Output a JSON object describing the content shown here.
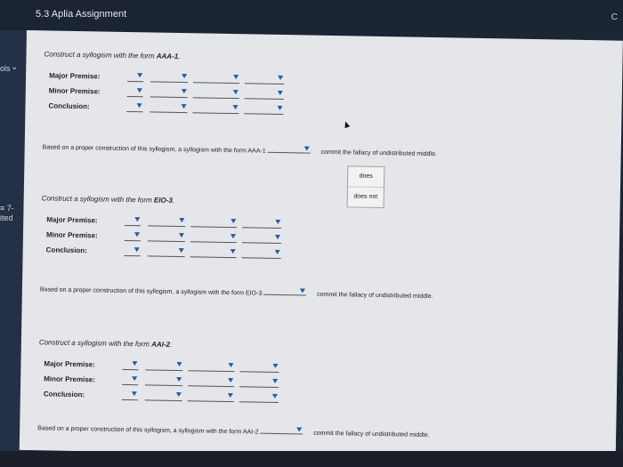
{
  "tab": {
    "title": "5.3 Aplia Assignment",
    "corner_char": "C"
  },
  "leftnav": {
    "item1": "ols",
    "item2": "≡ 7-",
    "item3": "ited"
  },
  "sections": [
    {
      "prompt_prefix": "Construct a syllogism with the form ",
      "form": "AAA-1",
      "prompt_suffix": ".",
      "labels": [
        "Major Premise:",
        "Minor Premise:",
        "Conclusion:"
      ],
      "based_text": "Based on a proper construction of this syllogism, a syllogism with the form AAA-1",
      "based_end": "commit the fallacy of undistributed middle."
    },
    {
      "prompt_prefix": "Construct a syllogism with the form ",
      "form": "EIO-3",
      "prompt_suffix": ".",
      "labels": [
        "Major Premise:",
        "Minor Premise:",
        "Conclusion:"
      ],
      "based_text": "Based on a proper construction of this syllogism, a syllogism with the form EIO-3",
      "based_end": "commit the fallacy of undistributed middle."
    },
    {
      "prompt_prefix": "Construct a syllogism with the form ",
      "form": "AAI-2",
      "prompt_suffix": ".",
      "labels": [
        "Major Premise:",
        "Minor Premise:",
        "Conclusion:"
      ],
      "based_text": "Based on a proper construction of this syllogism, a syllogism with the form AAI-2",
      "based_end": "commit the fallacy of undistributed middle."
    }
  ],
  "dropdown_menu": {
    "options": [
      "does",
      "does not"
    ]
  }
}
